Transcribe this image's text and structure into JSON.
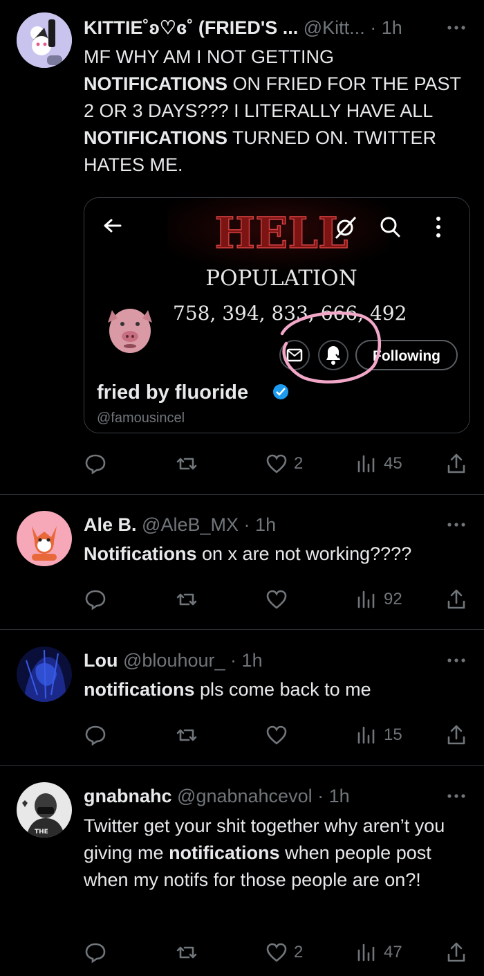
{
  "tweets": [
    {
      "name": "KITTIE˚ʚ♡ɞ˚ (FRIED'S ...",
      "handle": "@Kitt...",
      "dot": "·",
      "time": "1h",
      "text_parts": [
        "MF WHY AM I NOT GETTING ",
        "NOTIFICATIONS",
        " ON FRIED FOR THE PAST 2 OR 3 DAYS??? I LITERALLY HAVE ALL ",
        "NOTIFICATIONS",
        " TURNED ON. TWITTER HATES ME."
      ],
      "likes": "2",
      "views": "45"
    },
    {
      "name": "Ale B.",
      "handle": "@AleB_MX",
      "dot": "·",
      "time": "1h",
      "text_parts": [
        "Notifications",
        " on x are not working????"
      ],
      "likes": "",
      "views": "92"
    },
    {
      "name": "Lou",
      "handle": "@blouhour_",
      "dot": "·",
      "time": "1h",
      "text_parts": [
        "notifications",
        " pls come back to me"
      ],
      "likes": "",
      "views": "15"
    },
    {
      "name": "gnabnahc",
      "handle": "@gnabnahcevol",
      "dot": "·",
      "time": "1h",
      "text_parts": [
        "Twitter get your shit together why aren’t you giving me ",
        "notifications",
        " when people post when my notifs for those people are on?!"
      ],
      "likes": "2",
      "views": "47"
    }
  ],
  "embedded_profile": {
    "banner_title": "HELL",
    "banner_subtitle": "POPULATION",
    "banner_number": "758, 394, 833, 666, 492",
    "profile_name": "fried by fluoride",
    "profile_handle": "@famousincel",
    "following_button": "Following"
  },
  "colors": {
    "background": "#000000",
    "divider": "#2f3336",
    "secondary_text": "#71767b",
    "verified_badge": "#1d9bf0",
    "banner_red": "#8b1a1a",
    "circle_annotation": "#f2a7c8"
  }
}
